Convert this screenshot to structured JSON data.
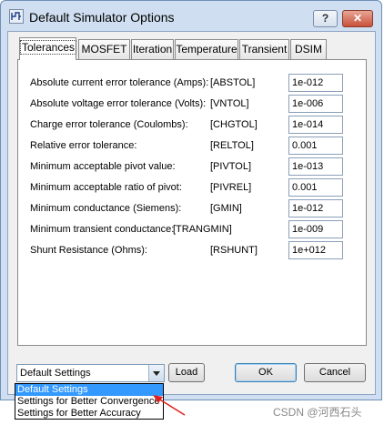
{
  "window": {
    "title": "Default Simulator Options"
  },
  "titlebar": {
    "help_label": "?",
    "close_label": "✕"
  },
  "tabs": [
    {
      "label": "Tolerances",
      "active": true
    },
    {
      "label": "MOSFET",
      "active": false
    },
    {
      "label": "Iteration",
      "active": false
    },
    {
      "label": "Temperature",
      "active": false
    },
    {
      "label": "Transient",
      "active": false
    },
    {
      "label": "DSIM",
      "active": false
    }
  ],
  "tolerances": [
    {
      "label": "Absolute current error tolerance (Amps):",
      "param": "[ABSTOL]",
      "value": "1e-012"
    },
    {
      "label": "Absolute voltage error tolerance (Volts):",
      "param": "[VNTOL]",
      "value": "1e-006"
    },
    {
      "label": "Charge error tolerance (Coulombs):",
      "param": "[CHGTOL]",
      "value": "1e-014"
    },
    {
      "label": "Relative error tolerance:",
      "param": "[RELTOL]",
      "value": "0.001"
    },
    {
      "label": "Minimum acceptable pivot value:",
      "param": "[PIVTOL]",
      "value": "1e-013"
    },
    {
      "label": "Minimum acceptable ratio of pivot:",
      "param": "[PIVREL]",
      "value": "0.001"
    },
    {
      "label": "Minimum conductance (Siemens):",
      "param": "[GMIN]",
      "value": "1e-012"
    },
    {
      "label": "Minimum transient conductance:",
      "param": "[TRANGMIN]",
      "value": "1e-009"
    },
    {
      "label": "Shunt Resistance (Ohms):",
      "param": "[RSHUNT]",
      "value": "1e+012"
    }
  ],
  "footer": {
    "settings_selected": "Default Settings",
    "load_label": "Load",
    "ok_label": "OK",
    "cancel_label": "Cancel"
  },
  "dropdown": {
    "options": [
      "Default Settings",
      "Settings for Better Convergence",
      "Settings for Better Accuracy"
    ],
    "highlighted_index": 0
  },
  "watermark": "CSDN @河西石头",
  "colors": {
    "selection": "#3399ff",
    "annotation_arrow": "#e02020"
  }
}
